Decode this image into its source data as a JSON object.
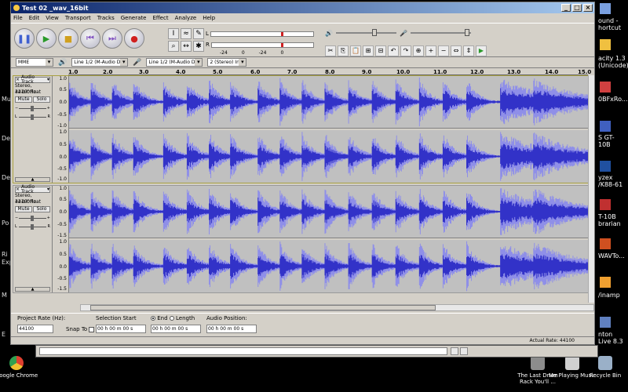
{
  "window": {
    "title": "Test 02 _wav_16bit",
    "controls": [
      "_",
      "□",
      "×"
    ]
  },
  "menu": [
    "File",
    "Edit",
    "View",
    "Transport",
    "Tracks",
    "Generate",
    "Effect",
    "Analyze",
    "Help"
  ],
  "meters": {
    "scale": [
      "-24",
      "0",
      "-24",
      "0"
    ],
    "left_label": "L",
    "right_label": "R"
  },
  "device": {
    "host": "MME",
    "input": "Line 1/2 (M-Audio Delta",
    "output": "Line 1/2 (M-Audio Delta",
    "channels": "2 (Stereo) Inp"
  },
  "ruler": [
    "1.0",
    "2.0",
    "3.0",
    "4.0",
    "5.0",
    "6.0",
    "7.0",
    "8.0",
    "9.0",
    "10.0",
    "11.0",
    "12.0",
    "13.0",
    "14.0",
    "15.0"
  ],
  "tracks": [
    {
      "name": "Audio Track",
      "format": "Stereo, 44100Hz",
      "bits": "32-bit float",
      "mute": "Mute",
      "solo": "Solo",
      "pan_l": "L",
      "pan_r": "R",
      "scale": [
        "1.0",
        "0.5",
        "0.0",
        "-0.5",
        "-1.0"
      ],
      "selected": true
    },
    {
      "name": "Audio Track",
      "format": "Stereo, 44100Hz",
      "bits": "32-bit float",
      "mute": "Mute",
      "solo": "Solo",
      "pan_l": "L",
      "pan_r": "R",
      "scale": [
        "1.0",
        "0.5",
        "0.0",
        "-0.5",
        "-1.5"
      ],
      "selected": false
    }
  ],
  "selection": {
    "project_rate_label": "Project Rate (Hz):",
    "project_rate": "44100",
    "snap_to": "Snap To",
    "start_label": "Selection Start",
    "start_value": "00 h 00 m 00 s",
    "end_label": "End",
    "length_label": "Length",
    "end_value": "00 h 00 m 00 s",
    "audio_pos_label": "Audio Position:",
    "audio_pos_value": "00 h 00 m 00 s"
  },
  "status": {
    "actual_rate": "Actual Rate: 44100"
  },
  "desktop_left": [
    "Mu",
    "De",
    "De",
    "Po",
    "Ri",
    "Exp",
    "M",
    "E"
  ],
  "desktop_right": [
    {
      "label": "ound - hortcut",
      "color": "#7aa0e0"
    },
    {
      "label": "acity 1.3 (Unicode)",
      "color": "#f0c040"
    },
    {
      "label": "0BFxRo...",
      "color": "#d04040"
    },
    {
      "label": "S GT-10B",
      "color": "#4060c0"
    },
    {
      "label": "yzex /K88-61",
      "color": "#2050a0"
    },
    {
      "label": "T-10B brarian",
      "color": "#c03030"
    },
    {
      "label": "WAVTo...",
      "color": "#d05020"
    },
    {
      "label": "/inamp",
      "color": "#f0a030"
    },
    {
      "label": "nton Live 8.3",
      "color": "#6080c0"
    }
  ],
  "desktop_icons": [
    {
      "label": "Google Chrome",
      "color": "#e04030"
    },
    {
      "label": "The Last Drum Rack You'll ...",
      "color": "#8c8c8c"
    },
    {
      "label": "Me Playing Music",
      "color": "#d0d0d0"
    },
    {
      "label": "Recycle Bin",
      "color": "#9ab0c8"
    }
  ]
}
